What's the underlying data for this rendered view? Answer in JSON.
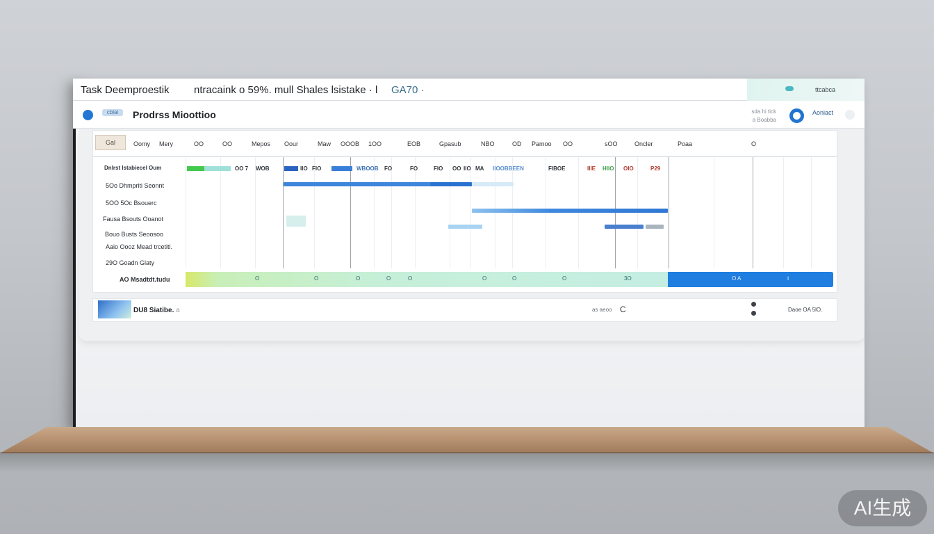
{
  "window": {
    "title": "Task Deemproestik",
    "subtitle": "ntracaink o 59%. mull Shales lsistake · l",
    "code": "GA70 ·",
    "corner_label": "ttcabca"
  },
  "app": {
    "logo_text": "cblai",
    "name": "Prodrss Mioottioo",
    "meta_line1": "sda hi tick",
    "meta_line2": "a Boabba",
    "account_label": "Aoniact"
  },
  "toolbar": {
    "thumb_label": "Gal",
    "labels": [
      "Oomy",
      "Mery",
      "OO",
      "OO",
      "Mepos",
      "Oour",
      "Maw",
      "OOOB",
      "1OO",
      "EOB",
      "Gpasub",
      "NBO",
      "OD",
      "Pamoo",
      "OO",
      "sOO",
      "Oncler",
      "Poaa",
      "O"
    ]
  },
  "gantt": {
    "header_label": "Dnlrst Istabiecel Oum",
    "header_texts": [
      "OO 7",
      "WOB",
      "IIO",
      "FIO",
      "WBOOB",
      "FO",
      "FO",
      "FIO",
      "OO",
      "IIO",
      "MA",
      "IIOOBBEEN",
      "FIBOE",
      "IIIE",
      "HIIO",
      "OIO",
      "P29"
    ],
    "tasks": [
      "5Oo Dhmpriti Seonnt",
      "5OO 5Oc Bsouerc",
      "Fausa Bsouts Ooanot",
      "Bouo Busts Seoosoo",
      "Aaio Oooz Mead trcetitl.",
      "29O Goadn Glaty"
    ],
    "track_label": "AO Msadtdt.tudu",
    "track_marks": [
      "O",
      "O",
      "O",
      "O",
      "O",
      "O",
      "O",
      "O",
      "3O",
      "O",
      "A",
      "t"
    ]
  },
  "status": {
    "title": "DU8 Siatibe.",
    "title_tail": "a",
    "mid_label": "as aeoo",
    "right_label": "Daoe OA 5lO."
  },
  "watermark": "AI生成",
  "colors": {
    "primary_blue": "#2277d4",
    "light_blue": "#9fcdf2",
    "green": "#45c94d",
    "teal_track": "#c4eee8",
    "red_text": "#c0392b"
  }
}
